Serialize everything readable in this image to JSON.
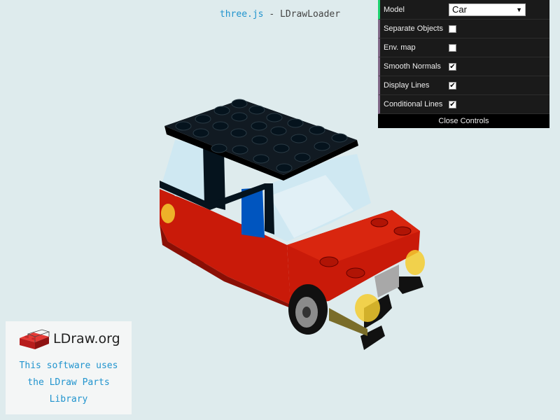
{
  "header": {
    "link_text": "three.js",
    "title_suffix": " - LDrawLoader"
  },
  "gui": {
    "model": {
      "label": "Model",
      "selected": "Car"
    },
    "options": [
      {
        "label": "Separate Objects",
        "checked": false
      },
      {
        "label": "Env. map",
        "checked": false
      },
      {
        "label": "Smooth Normals",
        "checked": true
      },
      {
        "label": "Display Lines",
        "checked": true
      },
      {
        "label": "Conditional Lines",
        "checked": true
      }
    ],
    "close_label": "Close Controls"
  },
  "badge": {
    "logo_text": "LDraw.org",
    "line1": "This software uses",
    "line2": "the LDraw Parts",
    "line3": "Library"
  },
  "icons": {
    "brick_logo": "brick-logo-icon",
    "checkmark": "checkmark-icon",
    "dropdown": "chevron-down-icon"
  },
  "colors": {
    "background": "#deebed",
    "link": "#2194ce",
    "brick_red": "#c91a09",
    "brick_black": "#05131d",
    "trans_clear": "#cde8f2",
    "trans_yellow": "#f5cd2f",
    "blue": "#0055bf"
  }
}
